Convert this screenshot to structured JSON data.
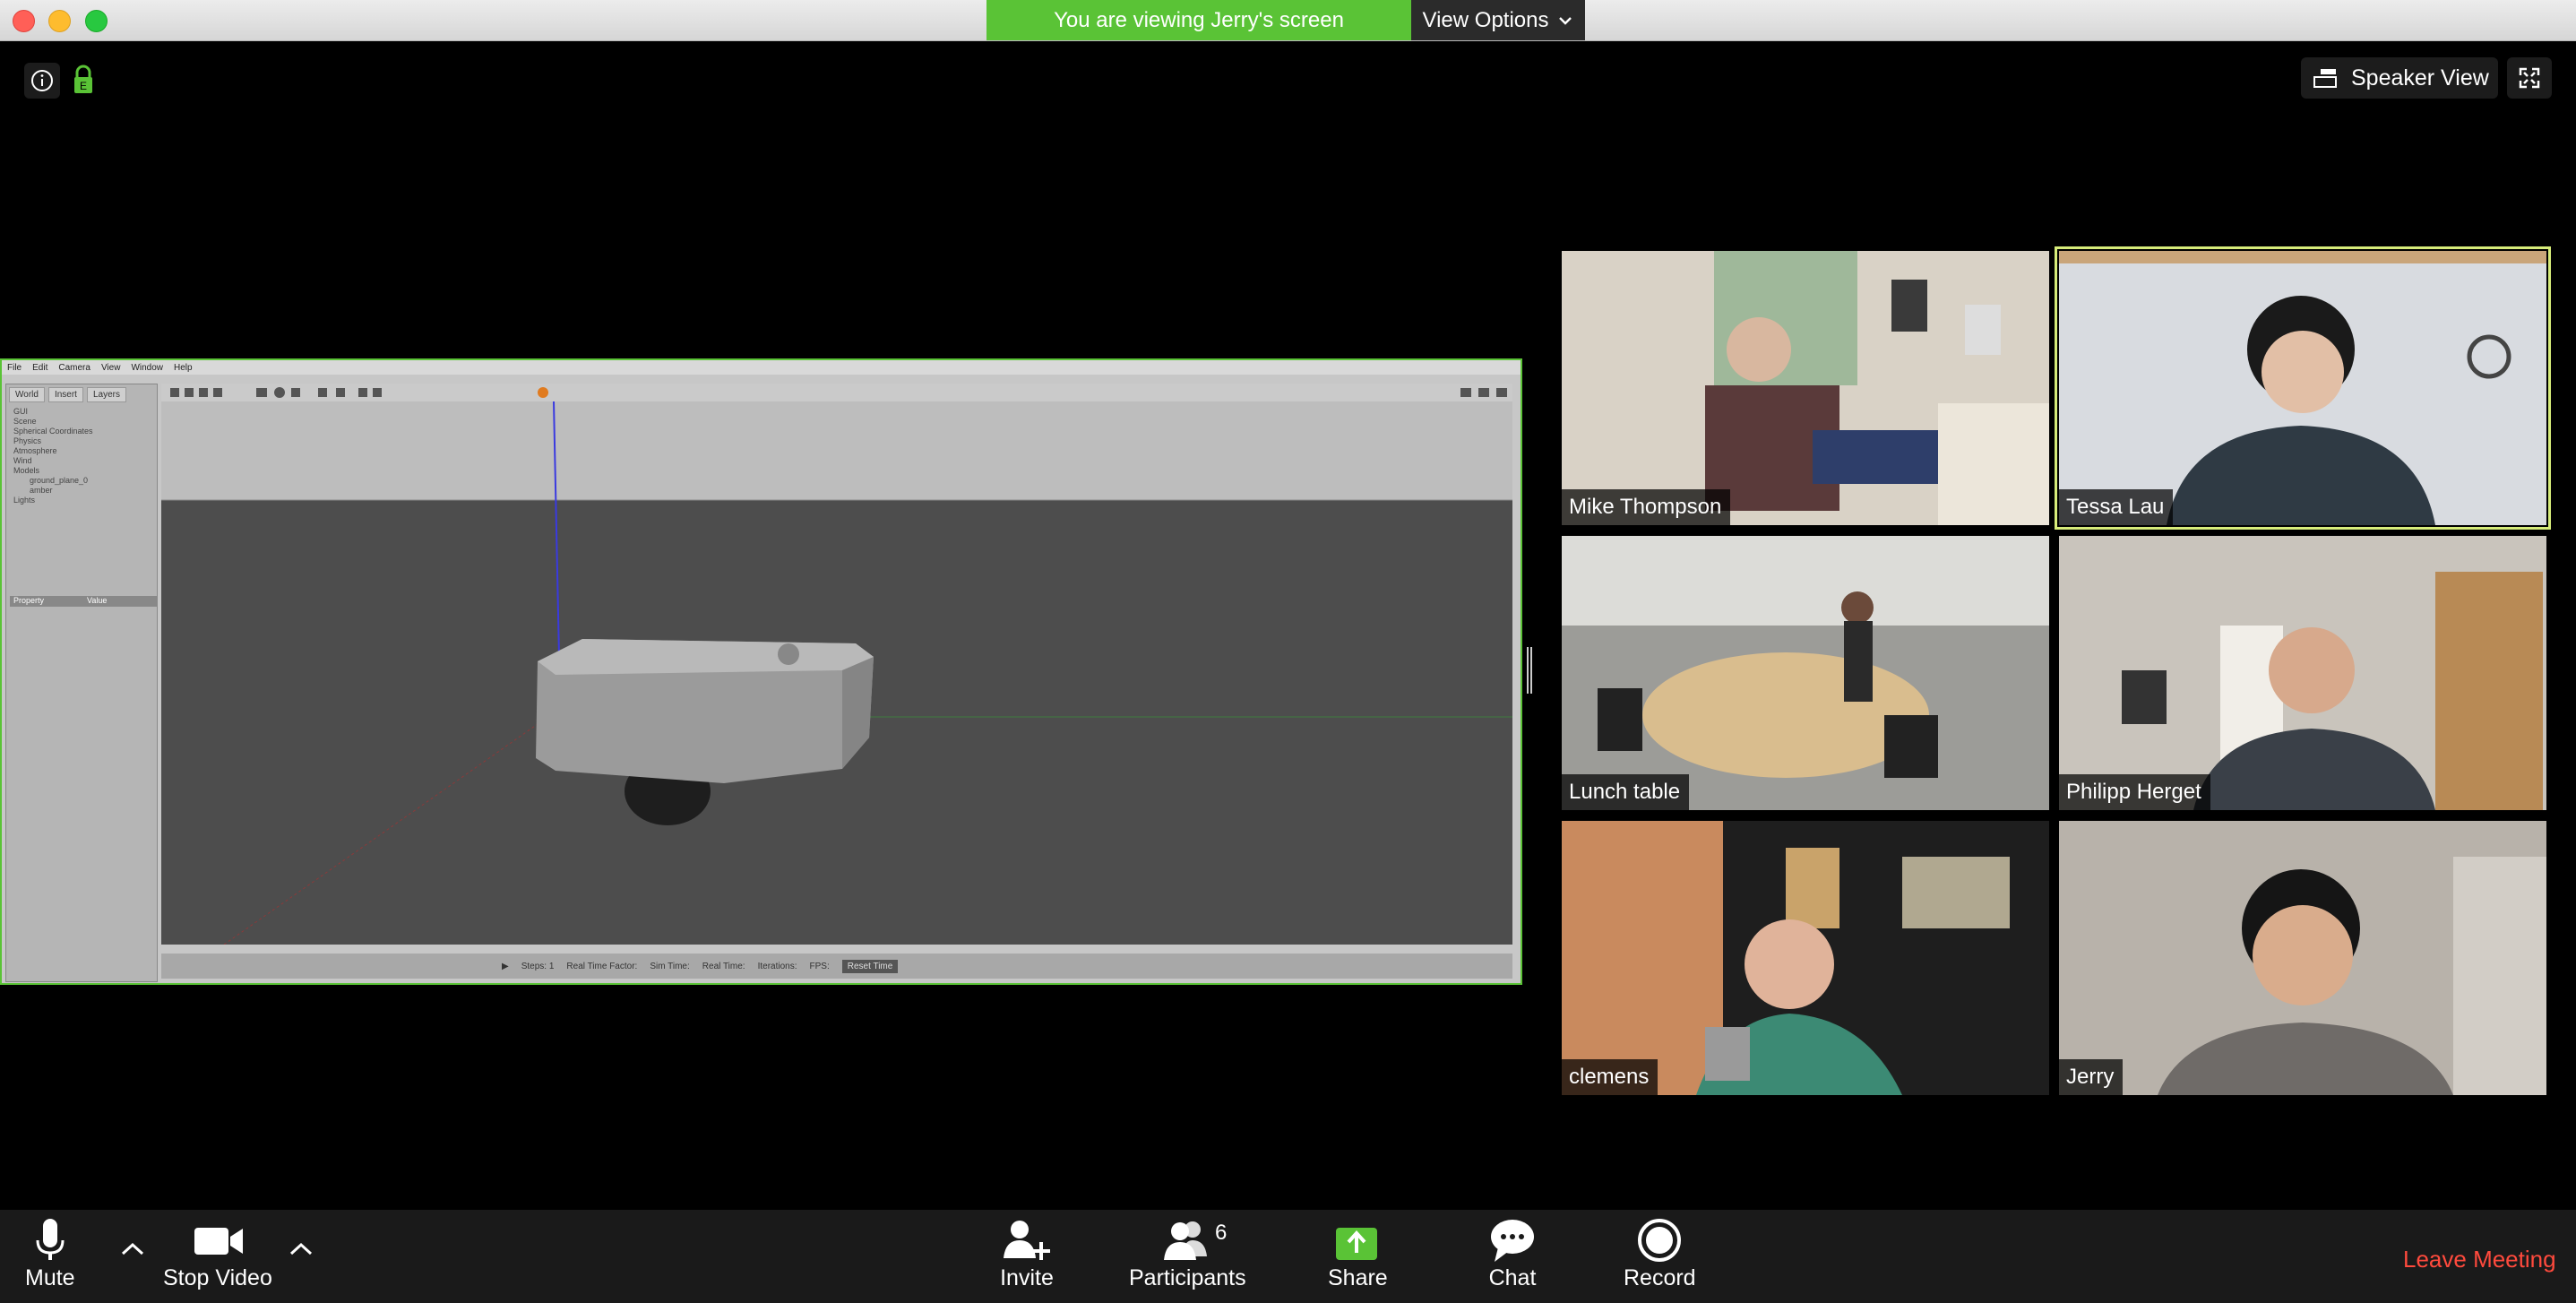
{
  "banner": {
    "viewing_text": "You are viewing Jerry's screen",
    "view_options_label": "View Options"
  },
  "top_right": {
    "speaker_view_label": "Speaker View"
  },
  "lock_badge": "E",
  "shared_screen": {
    "menu": [
      "File",
      "Edit",
      "Camera",
      "View",
      "Window",
      "Help"
    ],
    "panel_tabs": [
      "World",
      "Insert",
      "Layers"
    ],
    "tree": [
      "GUI",
      "Scene",
      "Spherical Coordinates",
      "Physics",
      "Atmosphere",
      "Wind",
      "Models",
      "ground_plane_0",
      "amber",
      "Lights"
    ],
    "property_header": [
      "Property",
      "Value"
    ],
    "status": {
      "steps": "Steps: 1",
      "real_time_factor": "Real Time Factor:",
      "sim_time": "Sim Time:",
      "real_time": "Real Time:",
      "iterations": "Iterations:",
      "fps": "FPS:",
      "reset_label": "Reset Time"
    }
  },
  "participants_tiles": [
    {
      "name": "Mike Thompson"
    },
    {
      "name": "Tessa Lau",
      "active": true
    },
    {
      "name": "Lunch table"
    },
    {
      "name": "Philipp Herget"
    },
    {
      "name": "clemens"
    },
    {
      "name": "Jerry"
    }
  ],
  "toolbar": {
    "mute": "Mute",
    "stop_video": "Stop Video",
    "invite": "Invite",
    "participants": "Participants",
    "participants_count": "6",
    "share": "Share",
    "chat": "Chat",
    "record": "Record",
    "leave": "Leave Meeting"
  },
  "colors": {
    "share_green": "#5ac336",
    "leave_red": "#ff4a3d",
    "active_speaker": "#d7ec7a"
  }
}
